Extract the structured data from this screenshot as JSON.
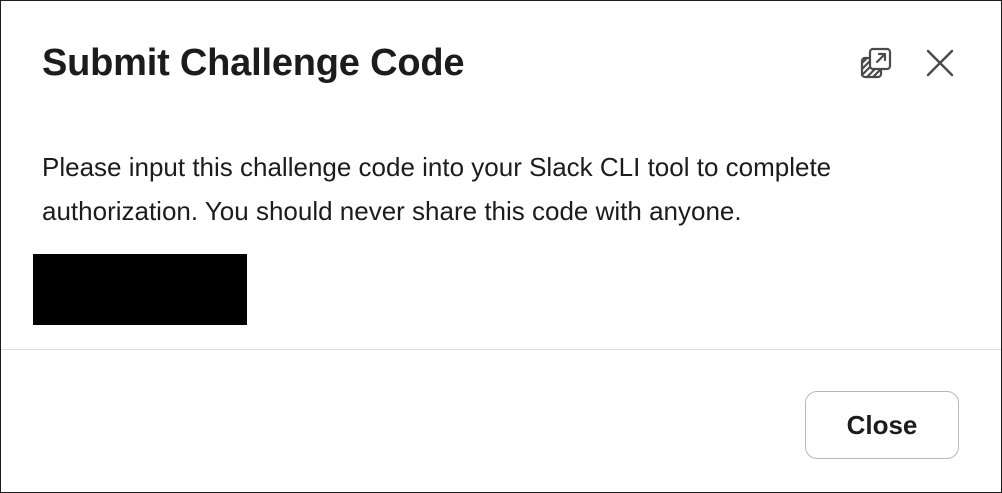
{
  "dialog": {
    "title": "Submit Challenge Code",
    "body_text": "Please input this challenge code into your Slack CLI tool to complete authorization. You should never share this code with anyone.",
    "close_button_label": "Close"
  },
  "icons": {
    "popout": "popout-icon",
    "close": "close-icon"
  },
  "colors": {
    "text": "#1d1c1d",
    "redaction": "#000000",
    "divider": "#dddddd",
    "button_border": "#b8b8b8"
  }
}
